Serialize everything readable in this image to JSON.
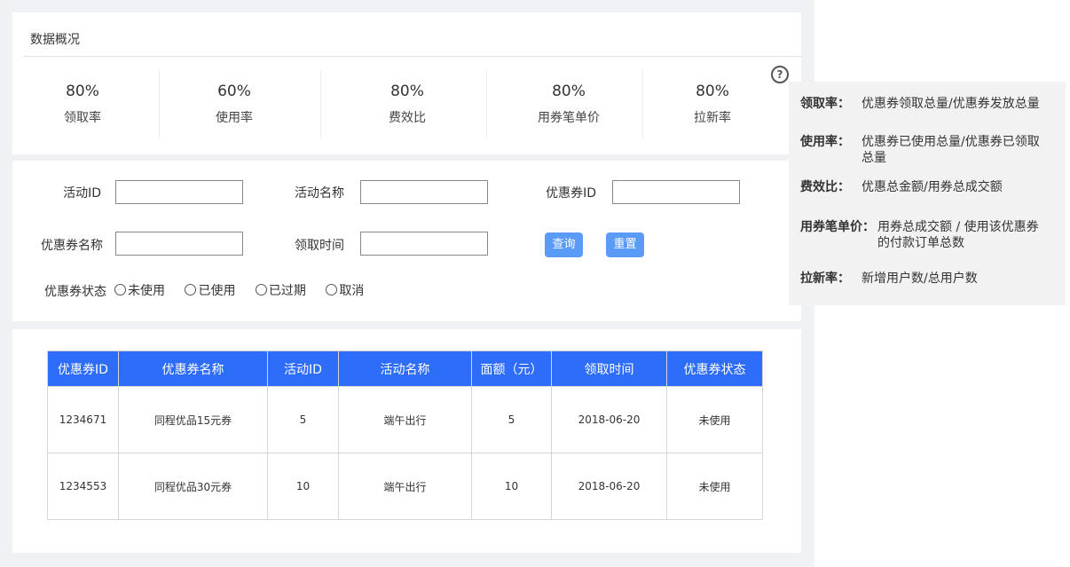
{
  "overview": {
    "title": "数据概况",
    "help_icon_glyph": "?",
    "metrics": [
      {
        "value": "80%",
        "label": "领取率"
      },
      {
        "value": "60%",
        "label": "使用率"
      },
      {
        "value": "80%",
        "label": "费效比"
      },
      {
        "value": "80%",
        "label": "用券笔单价"
      },
      {
        "value": "80%",
        "label": "拉新率"
      }
    ]
  },
  "filters": {
    "activity_id_label": "活动ID",
    "activity_name_label": "活动名称",
    "coupon_id_label": "优惠券ID",
    "coupon_name_label": "优惠券名称",
    "claim_time_label": "领取时间",
    "status_label": "优惠券状态",
    "inputs": {
      "activity_id": "",
      "activity_name": "",
      "coupon_id": "",
      "coupon_name": "",
      "claim_time": ""
    },
    "query_button": "查询",
    "reset_button": "重置",
    "status_options": [
      "未使用",
      "已使用",
      "已过期",
      "取消"
    ]
  },
  "table": {
    "headers": [
      "优惠券ID",
      "优惠券名称",
      "活动ID",
      "活动名称",
      "面额（元）",
      "领取时间",
      "优惠券状态"
    ],
    "rows": [
      [
        "1234671",
        "同程优品15元券",
        "5",
        "端午出行",
        "5",
        "2018-06-20",
        "未使用"
      ],
      [
        "1234553",
        "同程优品30元券",
        "10",
        "端午出行",
        "10",
        "2018-06-20",
        "未使用"
      ]
    ]
  },
  "tooltip": {
    "items": [
      {
        "key": "领取率：",
        "desc": "优惠券领取总量/优惠券发放总量"
      },
      {
        "key": "使用率：",
        "desc": "优惠券已使用总量/优惠券已领取总量"
      },
      {
        "key": "费效比：",
        "desc": "优惠总金额/用券总成交额"
      },
      {
        "key": "用券笔单价：",
        "desc": "用券总成交额 / 使用该优惠券的付款订单总数"
      },
      {
        "key": "拉新率：",
        "desc": "新增用户数/总用户数"
      }
    ]
  },
  "colors": {
    "page_bg": "#f0f1f5",
    "table_header": "#2e6cfa",
    "button": "#5a9bf8",
    "tooltip_bg": "#f2f2f2"
  }
}
